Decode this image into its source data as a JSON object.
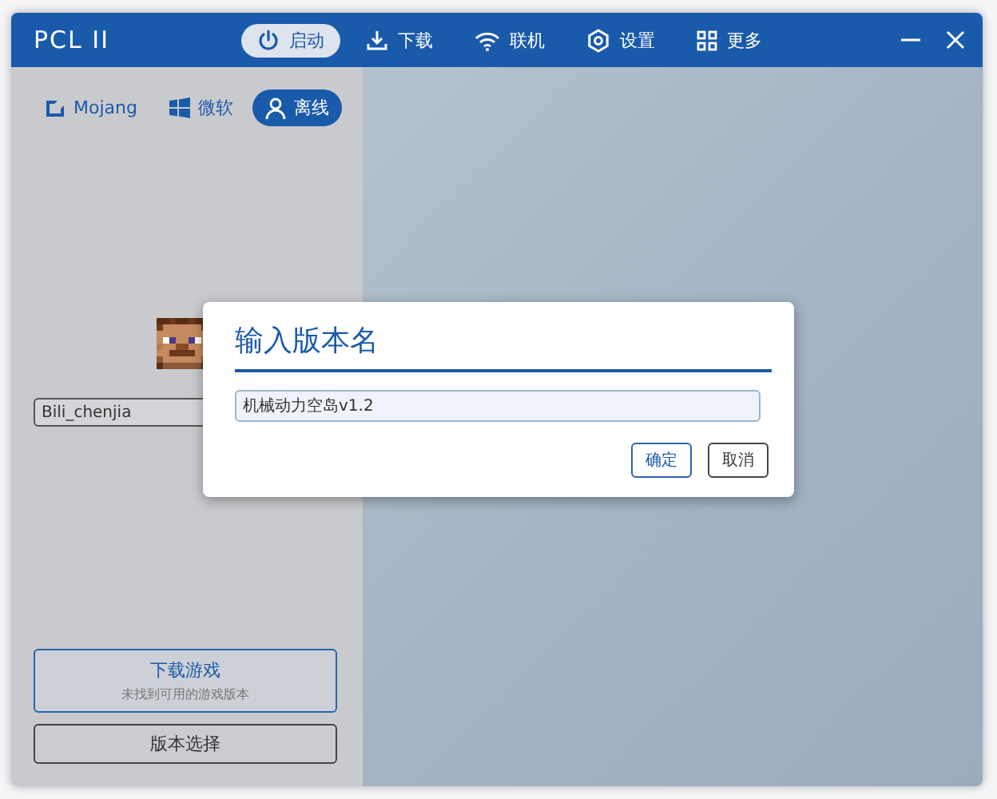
{
  "window": {
    "title": "PCL II"
  },
  "nav_tabs": [
    {
      "label": "启动",
      "kind": "power",
      "selected": true
    },
    {
      "label": "下载",
      "kind": "download",
      "selected": false
    },
    {
      "label": "联机",
      "kind": "wifi",
      "selected": false
    },
    {
      "label": "设置",
      "kind": "gear",
      "selected": false
    },
    {
      "label": "更多",
      "kind": "grid",
      "selected": false
    }
  ],
  "login_tabs": [
    {
      "label": "Mojang",
      "kind": "mojang",
      "selected": false
    },
    {
      "label": "微软",
      "kind": "windows",
      "selected": false
    },
    {
      "label": "离线",
      "kind": "person",
      "selected": true
    }
  ],
  "username": {
    "value": "Bili_chenjia"
  },
  "download_button": {
    "label": "下载游戏",
    "subtitle": "未找到可用的游戏版本"
  },
  "version_button": {
    "label": "版本选择"
  },
  "dialog": {
    "title": "输入版本名",
    "input": {
      "value": "机械动力空岛v1.2"
    },
    "buttons": [
      {
        "label": "确定",
        "kind": "primary"
      },
      {
        "label": "取消",
        "kind": "secondary"
      }
    ]
  }
}
